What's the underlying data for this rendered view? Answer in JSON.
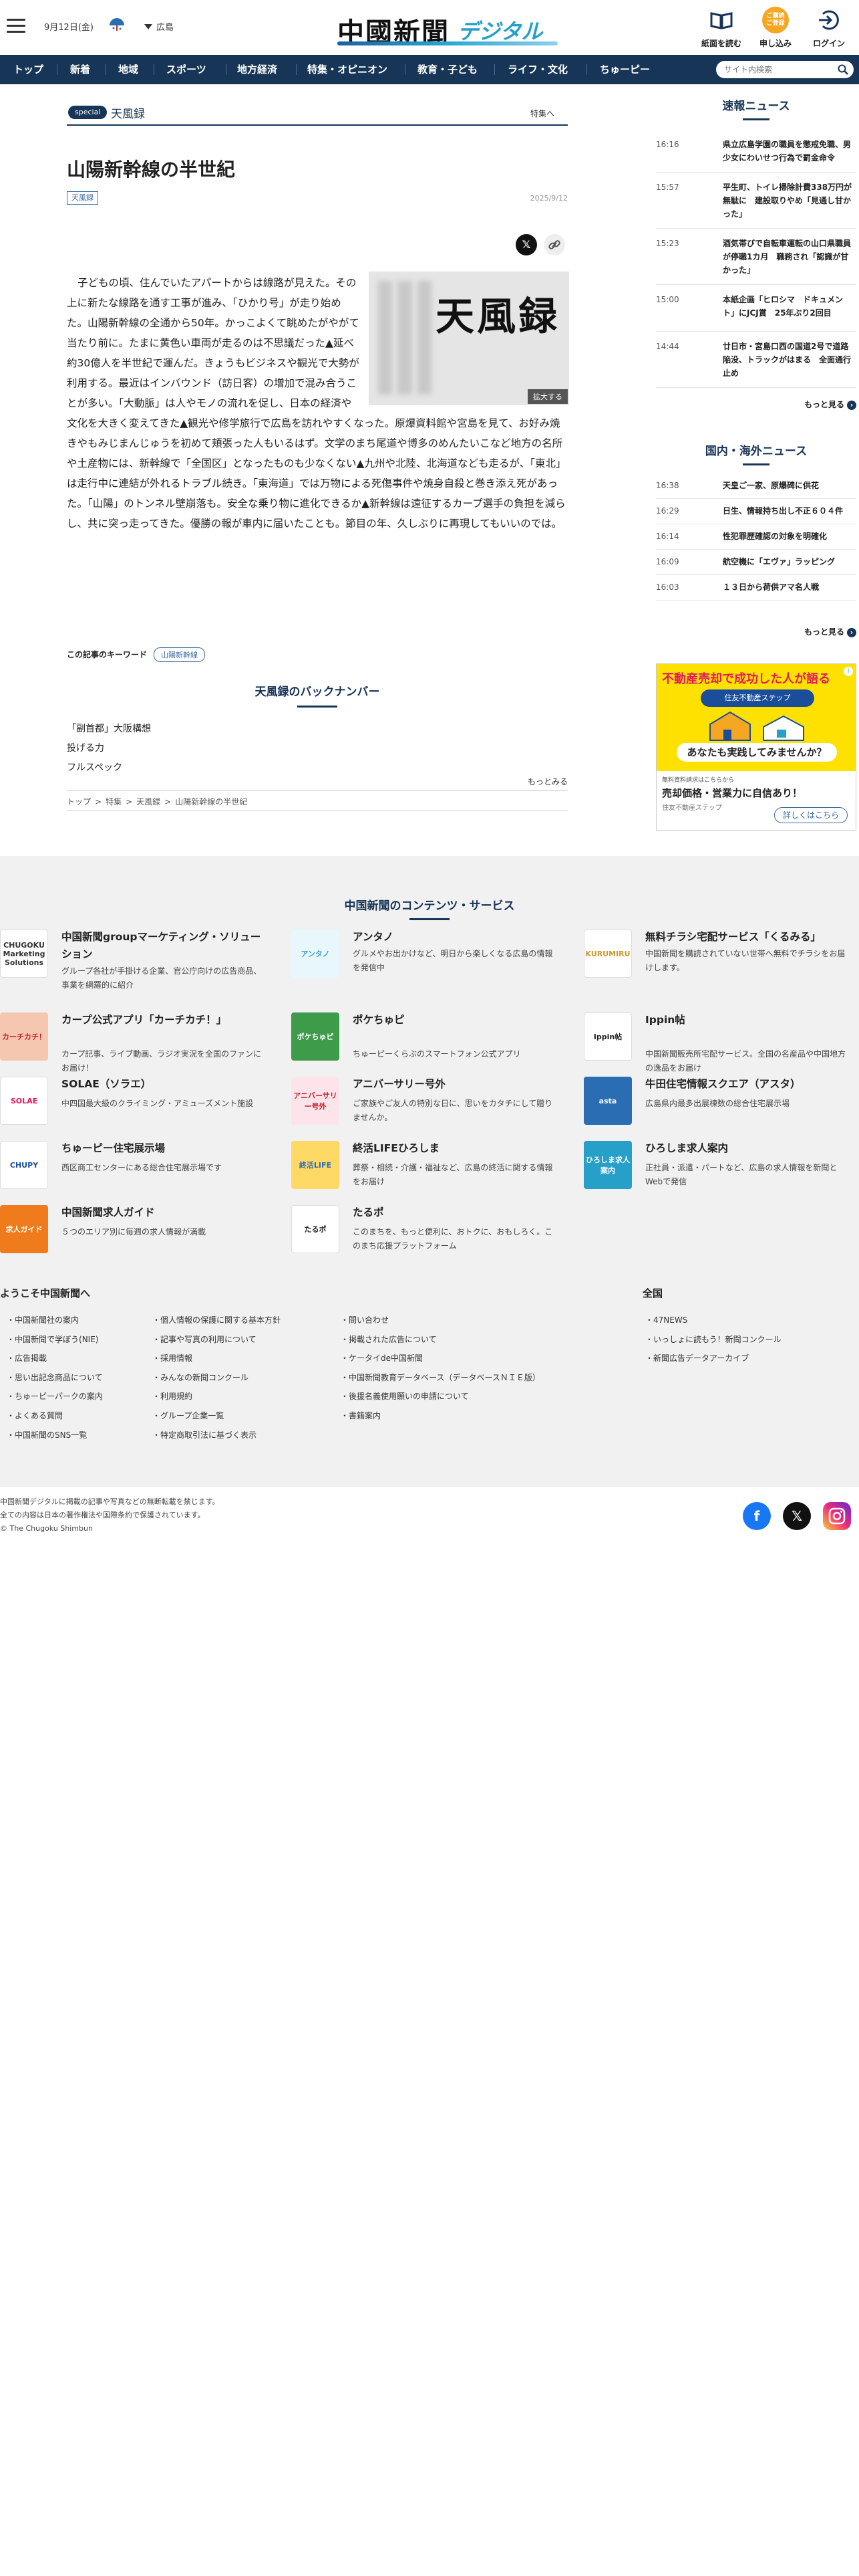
{
  "header": {
    "date": "9月12日(金)",
    "area": "広島",
    "logo_main": "中國新聞",
    "logo_sub": "デジタル",
    "btn_read": "紙面を読む",
    "btn_apply": "申し込み",
    "btn_apply_badge": "ご購読\nご登録",
    "btn_login": "ログイン"
  },
  "nav": {
    "items": [
      "トップ",
      "新着",
      "地域",
      "スポーツ",
      "地方経済",
      "特集・オピニオン",
      "教育・子ども",
      "ライフ・文化",
      "ちゅーピー"
    ],
    "search_placeholder": "サイト内検索"
  },
  "article": {
    "special_label": "special",
    "special_name": "天風録",
    "special_link": "特集へ",
    "title": "山陽新幹線の半世紀",
    "tag": "天風録",
    "date": "2025/9/12",
    "figure_title": "天風録",
    "figure_zoom": "拡大する",
    "body": "子どもの頃、住んでいたアパートからは線路が見えた。その上に新たな線路を通す工事が進み、「ひかり号」が走り始めた。山陽新幹線の全通から50年。かっこよくて眺めたがやがて当たり前に。たまに黄色い車両が走るのは不思議だった▲延べ約30億人を半世紀で運んだ。きょうもビジネスや観光で大勢が利用する。最近はインバウンド（訪日客）の増加で混み合うことが多い。「大動脈」は人やモノの流れを促し、日本の経済や文化を大きく変えてきた▲観光や修学旅行で広島を訪れやすくなった。原爆資料館や宮島を見て、お好み焼きやもみじまんじゅうを初めて頬張った人もいるはず。文学のまち尾道や博多のめんたいこなど地方の名所や土産物には、新幹線で「全国区」となったものも少なくない▲九州や北陸、北海道なども走るが、「東北」は走行中に連結が外れるトラブル続き。「東海道」では万物による死傷事件や焼身自殺と巻き添え死があった。「山陽」のトンネル壁崩落も。安全な乗り物に進化できるか▲新幹線は遠征するカープ選手の負担を減らし、共に突っ走ってきた。優勝の報が車内に届いたことも。節目の年、久しぶりに再現してもいいのでは。",
    "keyword_label": "この記事のキーワード",
    "keyword": "山陽新幹線",
    "backnumber_title": "天風録のバックナンバー",
    "backnumbers": [
      "「副首都」大阪構想",
      "投げる力",
      "フルスペック"
    ],
    "backnumber_more": "もっとみる",
    "breadcrumb": [
      "トップ",
      "特集",
      "天風録",
      "山陽新幹線の半世紀"
    ]
  },
  "sidebar": {
    "breaking_title": "速報ニュース",
    "breaking": [
      {
        "time": "16:16",
        "text": "県立広島学園の職員を懲戒免職、男少女にわいせつ行為で罰金命令"
      },
      {
        "time": "15:57",
        "text": "平生町、トイレ掃除計費338万円が無駄に　建設取りやめ「見通し甘かった」"
      },
      {
        "time": "15:23",
        "text": "酒気帯びで自転車運転の山口県職員が停職1カ月　職務され「認識が甘かった」"
      },
      {
        "time": "15:00",
        "text": "本紙企画「ヒロシマ　ドキュメント」にJCJ賞　25年ぶり2回目"
      },
      {
        "time": "14:44",
        "text": "廿日市・宮島口西の国道2号で道路陥没、トラックがはまる　全面通行止め"
      }
    ],
    "breaking_more": "もっと見る",
    "domestic_title": "国内・海外ニュース",
    "domestic": [
      {
        "time": "16:38",
        "text": "天皇ご一家、原爆碑に供花"
      },
      {
        "time": "16:29",
        "text": "日生、情報持ち出し不正６０４件"
      },
      {
        "time": "16:14",
        "text": "性犯罪歴確認の対象を明確化"
      },
      {
        "time": "16:09",
        "text": "航空機に「エヴァ」ラッピング"
      },
      {
        "time": "16:03",
        "text": "１３日から荷供アマ名人戦"
      }
    ],
    "domestic_more": "もっと見る",
    "ad": {
      "headline": "不動産売却で成功した人が語る",
      "brand": "住友不動産ステップ",
      "question": "あなたも実践してみませんか？",
      "small": "無料資料請求はこちらから",
      "main": "売却価格・営業力に自信あり！",
      "sub": "住友不動産ステップ",
      "button": "詳しくはこちら",
      "info": "i"
    }
  },
  "services": {
    "title": "中国新聞のコンテンツ・サービス",
    "items": [
      {
        "name": "中国新聞groupマーケティング・ソリューション",
        "desc": "グループ各社が手掛ける企業、官公庁向けの広告商品、事業を網羅的に紹介",
        "thumb": "CHUGOKU\nMarketing Solutions",
        "color": "#ffffff",
        "fg": "#333333"
      },
      {
        "name": "アンタノ",
        "desc": "グルメやお出かけなど、明日から楽しくなる広島の情報を発信中",
        "thumb": "アンタノ",
        "color": "#e8f7fb",
        "fg": "#3aa6c4"
      },
      {
        "name": "無料チラシ宅配サービス「くるみる」",
        "desc": "中国新聞を購読されていない世帯へ無料でチラシをお届けします。",
        "thumb": "KURUMIRU",
        "color": "#ffffff",
        "fg": "#c99a2e"
      },
      {
        "name": "カープ公式アプリ「カーチカチ！」",
        "desc": "カープ記事、ライブ動画、ラジオ実況を全国のファンにお届け！",
        "thumb": "カーチカチ！",
        "color": "#f6c7b0",
        "fg": "#c0202a"
      },
      {
        "name": "ポケちゅピ",
        "desc": "ちゅーピーくらぶのスマートフォン公式アプリ",
        "thumb": "ポケちゅピ",
        "color": "#3e9b4a",
        "fg": "#ffffff"
      },
      {
        "name": "Ippin帖",
        "desc": "中国新聞販売所宅配サービス。全国の名産品や中国地方の逸品をお届け",
        "thumb": "Ippin帖",
        "color": "#ffffff",
        "fg": "#222222"
      },
      {
        "name": "SOLAE（ソラエ）",
        "desc": "中四国最大級のクライミング・アミューズメント施設",
        "thumb": "SOLAE",
        "color": "#ffffff",
        "fg": "#e0195d"
      },
      {
        "name": "アニバーサリー号外",
        "desc": "ご家族やご友人の特別な日に、思いをカタチにして贈りませんか。",
        "thumb": "アニバーサリー号外",
        "color": "#fde3ea",
        "fg": "#c0202a"
      },
      {
        "name": "牛田住宅情報スクエア（アスタ）",
        "desc": "広島県内最多出展棟数の総合住宅展示場",
        "thumb": "asta",
        "color": "#2a6db3",
        "fg": "#ffffff"
      },
      {
        "name": "ちゅーピー住宅展示場",
        "desc": "西区商工センターにある総合住宅展示場です",
        "thumb": "CHUPY",
        "color": "#ffffff",
        "fg": "#1a4e9a"
      },
      {
        "name": "終活LIFEひろしま",
        "desc": "葬祭・相続・介護・福祉など、広島の終活に関する情報をお届け",
        "thumb": "終活LIFE",
        "color": "#ffd966",
        "fg": "#2a6db3"
      },
      {
        "name": "ひろしま求人案内",
        "desc": "正社員・派遣・パートなど、広島の求人情報を新聞とWebで発信",
        "thumb": "ひろしま求人案内",
        "color": "#26a0c8",
        "fg": "#ffffff"
      },
      {
        "name": "中国新聞求人ガイド",
        "desc": "５つのエリア別に毎週の求人情報が満載",
        "thumb": "求人ガイド",
        "color": "#f07b1d",
        "fg": "#ffffff"
      },
      {
        "name": "たるポ",
        "desc": "このまちを、もっと便利に、おトクに、おもしろく。このまち応援プラットフォーム",
        "thumb": "たるポ",
        "color": "#ffffff",
        "fg": "#222222"
      }
    ]
  },
  "links": {
    "title_welcome": "ようこそ中国新聞へ",
    "title_national": "全国",
    "col1": [
      "中国新聞社の案内",
      "中国新聞で学ぼう(NIE)",
      "広告掲載",
      "思い出記念商品について",
      "ちゅーピーパークの案内",
      "よくある質問",
      "中国新聞のSNS一覧"
    ],
    "col2": [
      "個人情報の保護に関する基本方針",
      "記事や写真の利用について",
      "採用情報",
      "みんなの新聞コンクール",
      "利用規約",
      "グループ企業一覧",
      "特定商取引法に基づく表示"
    ],
    "col3": [
      "問い合わせ",
      "掲載された広告について",
      "ケータイde中国新聞",
      "中国新聞教育データベース（データベースＮＩＥ版）",
      "後援名義使用願いの申請について",
      "書籍案内"
    ],
    "col4": [
      "47NEWS",
      "いっしょに読もう！新聞コンクール",
      "新聞広告データアーカイブ"
    ]
  },
  "footer": {
    "line1": "中国新聞デジタルに掲載の記事や写真などの無断転載を禁じます。",
    "line2": "全ての内容は日本の著作権法や国際条約で保護されています。",
    "line3": "© The Chugoku Shimbun"
  },
  "colors": {
    "navy": "#173556",
    "accent_blue": "#3b6aa0",
    "apply_orange": "#f5a623"
  }
}
